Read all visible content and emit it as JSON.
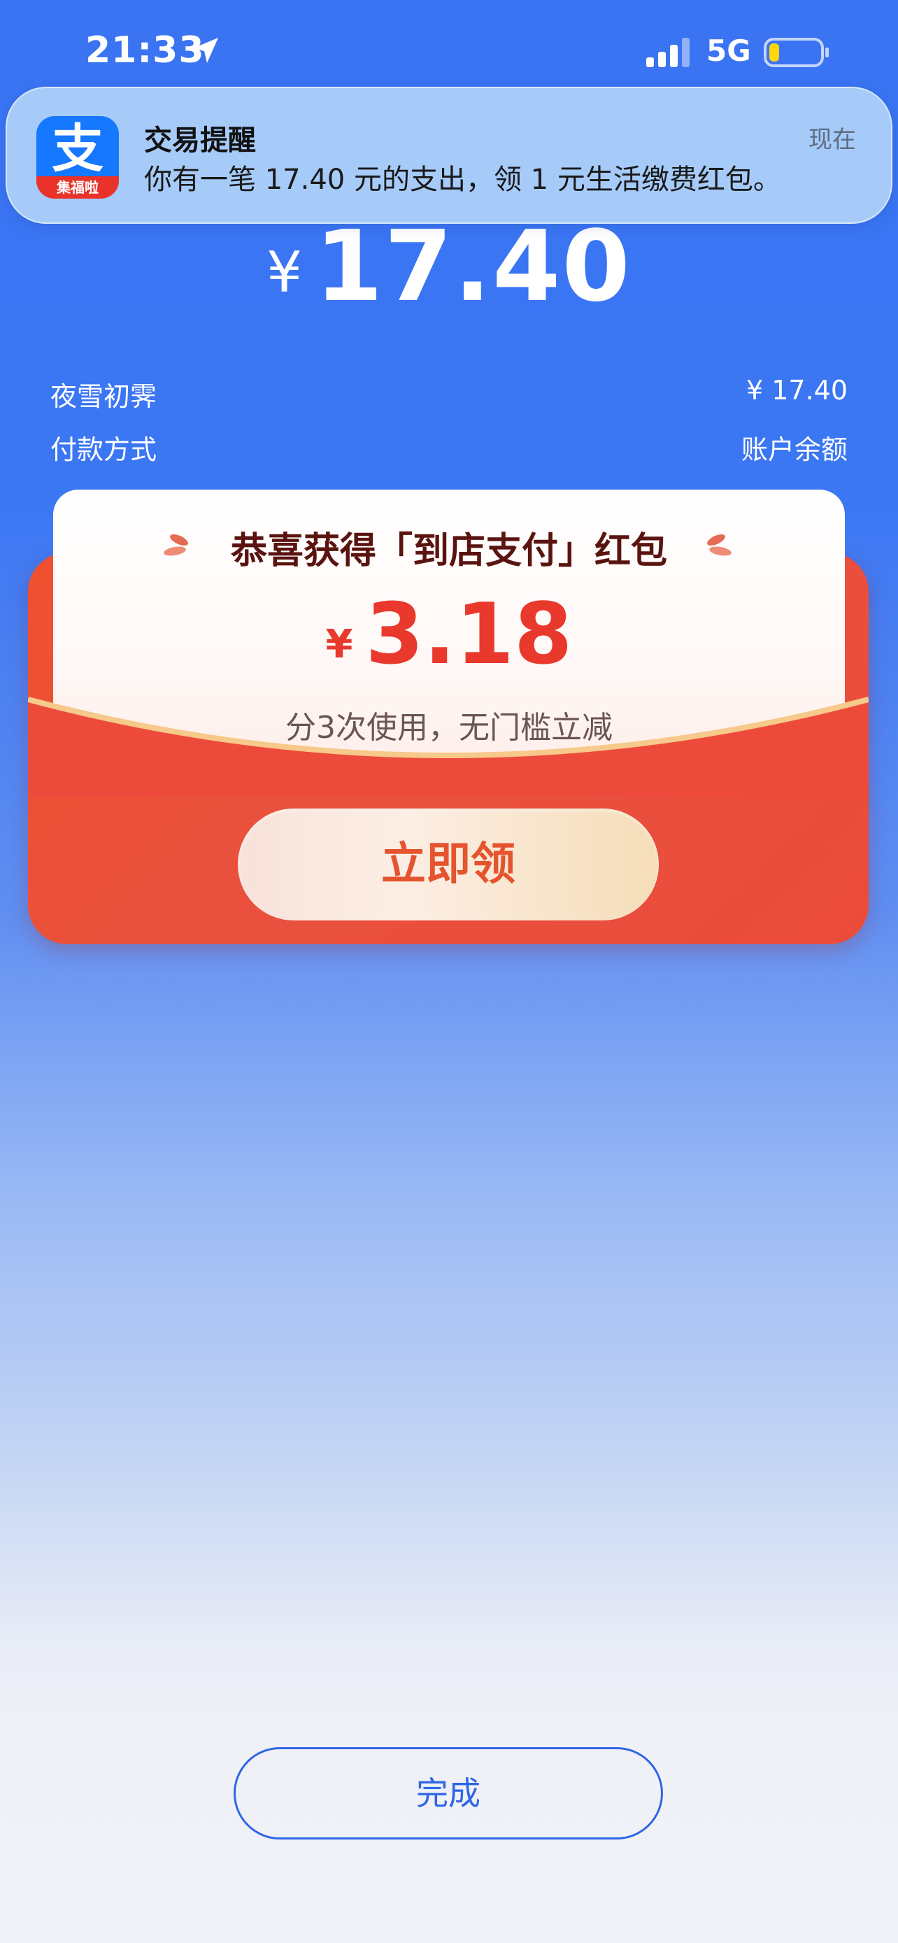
{
  "status_bar": {
    "time": "21:33",
    "network": "5G",
    "battery_level": 0.15
  },
  "notification": {
    "app_icon_glyph": "支",
    "app_icon_badge": "集福啦",
    "title": "交易提醒",
    "time": "现在",
    "body": "你有一笔 17.40 元的支出，领 1 元生活缴费红包。"
  },
  "payment": {
    "currency": "¥",
    "amount": "17.40",
    "rows": [
      {
        "label": "夜雪初霁",
        "value": "¥ 17.40"
      },
      {
        "label": "付款方式",
        "value": "账户余额"
      }
    ]
  },
  "red_packet": {
    "title": "恭喜获得「到店支付」红包",
    "currency": "¥",
    "amount": "3.18",
    "description": "分3次使用，无门槛立减",
    "claim_label": "立即领"
  },
  "footer": {
    "done_label": "完成"
  },
  "colors": {
    "primary_blue": "#3A74F3",
    "red": "#E8392C",
    "button_blue": "#2F66E6"
  }
}
